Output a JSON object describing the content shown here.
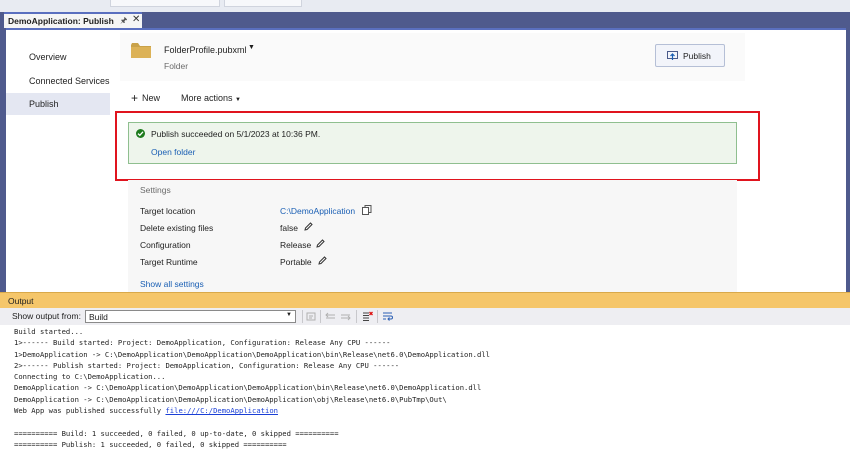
{
  "document_tab": {
    "title": "DemoApplication: Publish",
    "pin_icon": "pin-icon",
    "close_icon": "close-icon"
  },
  "nav": {
    "items": [
      {
        "label": "Overview",
        "active": false
      },
      {
        "label": "Connected Services",
        "active": false
      },
      {
        "label": "Publish",
        "active": true
      }
    ]
  },
  "profile": {
    "name": "FolderProfile.pubxml",
    "type": "Folder",
    "publish_button": "Publish",
    "icon": "folder-icon"
  },
  "toolbar": {
    "new_label": "New",
    "more_actions_label": "More actions"
  },
  "status": {
    "message": "Publish succeeded on 5/1/2023 at 10:36 PM.",
    "open_folder_link": "Open folder",
    "color": "#1e7b1e"
  },
  "settings": {
    "title": "Settings",
    "rows": [
      {
        "label": "Target location",
        "value": "C:\\DemoApplication"
      },
      {
        "label": "Delete existing files",
        "value": "false"
      },
      {
        "label": "Configuration",
        "value": "Release"
      },
      {
        "label": "Target Runtime",
        "value": "Portable"
      }
    ],
    "show_all_link": "Show all settings"
  },
  "output": {
    "title": "Output",
    "show_output_from_label": "Show output from:",
    "source": "Build",
    "lines": [
      "Build started...",
      "1>------ Build started: Project: DemoApplication, Configuration: Release Any CPU ------",
      "1>DemoApplication -> C:\\DemoApplication\\DemoApplication\\DemoApplication\\bin\\Release\\net6.0\\DemoApplication.dll",
      "2>------ Publish started: Project: DemoApplication, Configuration: Release Any CPU ------",
      "Connecting to C:\\DemoApplication...",
      "DemoApplication -> C:\\DemoApplication\\DemoApplication\\DemoApplication\\bin\\Release\\net6.0\\DemoApplication.dll",
      "DemoApplication -> C:\\DemoApplication\\DemoApplication\\DemoApplication\\obj\\Release\\net6.0\\PubTmp\\Out\\"
    ],
    "publish_line_prefix": "Web App was published successfully ",
    "publish_link": "file:///C:/DemoApplication",
    "summary_lines": [
      "========== Build: 1 succeeded, 0 failed, 0 up-to-date, 0 skipped ==========",
      "========== Publish: 1 succeeded, 0 failed, 0 skipped =========="
    ]
  },
  "colors": {
    "accent": "#4f5a8d",
    "link": "#1a5fb4",
    "highlight": "#e0141e",
    "output_header": "#f5c66a"
  }
}
